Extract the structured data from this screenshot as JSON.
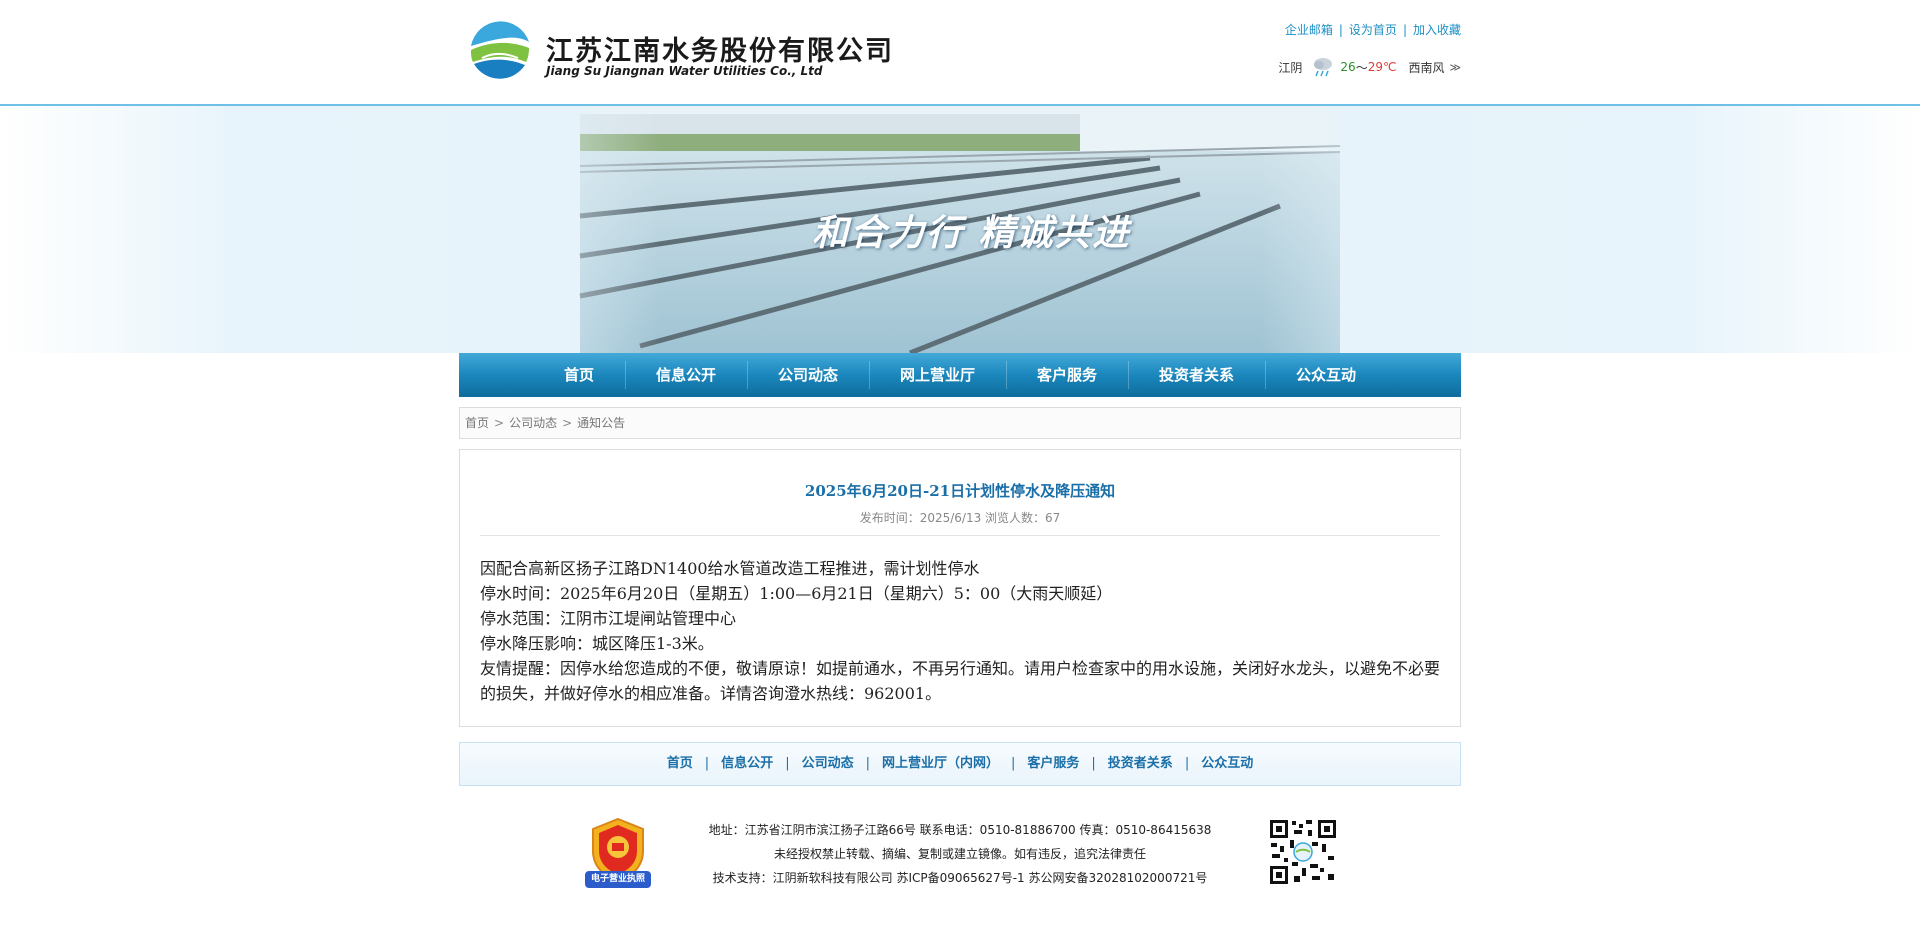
{
  "header": {
    "company_name": "江苏江南水务股份有限公司",
    "company_name_en": "Jiang Su Jiangnan Water Utilities Co., Ltd",
    "top_links": [
      "企业邮箱",
      "设为首页",
      "加入收藏"
    ],
    "weather": {
      "city": "江阴",
      "temp_low": "26",
      "temp_sep": "～",
      "temp_high": "29℃",
      "wind": "西南风",
      "more": "≫",
      "icon": "rain-cloud-icon"
    }
  },
  "banner": {
    "slogan": "和合力行 精诚共进"
  },
  "nav": {
    "items": [
      "首页",
      "信息公开",
      "公司动态",
      "网上营业厅",
      "客户服务",
      "投资者关系",
      "公众互动"
    ]
  },
  "breadcrumb": {
    "items": [
      "首页",
      "公司动态",
      "通知公告"
    ],
    "separator": ">"
  },
  "article": {
    "title": "2025年6月20日-21日计划性停水及降压通知",
    "meta": "发布时间：2025/6/13 浏览人数：67",
    "paragraphs": [
      "因配合高新区扬子江路DN1400给水管道改造工程推进，需计划性停水",
      "停水时间：2025年6月20日（星期五）1:00—6月21日（星期六）5：00（大雨天顺延）",
      "停水范围：江阴市江堤闸站管理中心",
      "停水降压影响：城区降压1-3米。",
      "友情提醒：因停水给您造成的不便，敬请原谅！如提前通水，不再另行通知。请用户检查家中的用水设施，关闭好水龙头，以避免不必要的损失，并做好停水的相应准备。详情咨询澄水热线：962001。"
    ]
  },
  "bottom_nav": {
    "items": [
      "首页",
      "信息公开",
      "公司动态",
      "网上营业厅（内网）",
      "客户服务",
      "投资者关系",
      "公众互动"
    ],
    "separator": "|"
  },
  "footer": {
    "badge_label": "电子营业执照",
    "lines": [
      "地址：江苏省江阴市滨江扬子江路66号  联系电话：0510-81886700  传真：0510-86415638",
      "未经授权禁止转载、摘编、复制或建立镜像。如有违反，追究法律责任",
      "技术支持：江阴新软科技有限公司  苏ICP备09065627号-1  苏公网安备32028102000721号"
    ]
  },
  "colors": {
    "brand_blue": "#1b87bd",
    "link_blue": "#1b8fc6",
    "title_blue": "#1b6fa8",
    "temp_low_green": "#2a8f2a",
    "temp_high_red": "#e03a3a"
  }
}
